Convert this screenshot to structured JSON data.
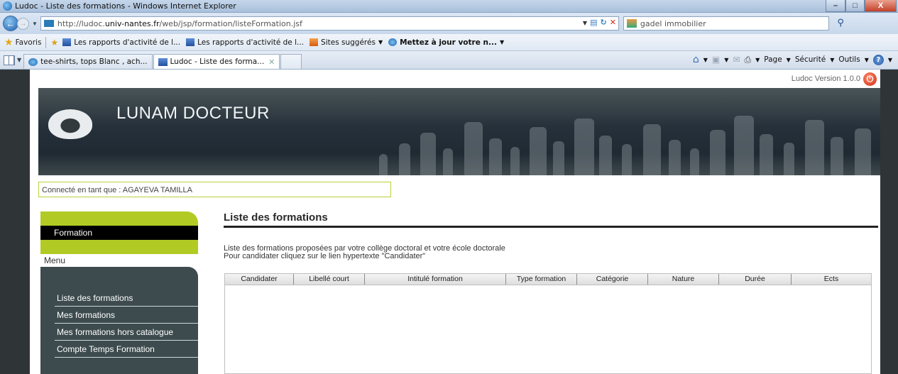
{
  "window": {
    "title": "Ludoc - Liste des formations - Windows Internet Explorer",
    "buttons": {
      "minimize": "–",
      "maximize": "□",
      "close": "X"
    }
  },
  "address": {
    "url_prefix": "http://ludoc.",
    "url_host": "univ-nantes.fr",
    "url_path": "/web/jsp/formation/listeFormation.jsf",
    "search_value": "gadel immobilier"
  },
  "favorites": {
    "label": "Favoris",
    "items": [
      {
        "label": "Les rapports d'activité de l...",
        "icon": "report-icon"
      },
      {
        "label": "Les rapports d'activité de l...",
        "icon": "report-icon"
      },
      {
        "label": "Sites suggérés",
        "icon": "suggested-sites-icon"
      },
      {
        "label": "Mettez à jour votre n...",
        "icon": "ie-icon"
      }
    ]
  },
  "tabs": {
    "items": [
      {
        "label": "tee-shirts, tops Blanc , ach..."
      },
      {
        "label": "Ludoc - Liste des forma..."
      }
    ],
    "commands": {
      "page": "Page",
      "security": "Sécurité",
      "tools": "Outils"
    }
  },
  "app": {
    "version": "Ludoc Version 1.0.0",
    "brand": "LUNAM DOCTEUR",
    "logged_in": "Connecté en tant que : AGAYEVA  TAMILLA"
  },
  "sidebar": {
    "section": "Formation",
    "menu_label": "Menu",
    "items": [
      {
        "label": "Liste des formations"
      },
      {
        "label": "Mes formations"
      },
      {
        "label": "Mes formations hors catalogue"
      },
      {
        "label": "Compte Temps Formation"
      }
    ]
  },
  "main": {
    "title": "Liste des formations",
    "intro_line1": "Liste des formations proposées par votre collège doctoral et votre école doctorale",
    "intro_line2": "Pour candidater cliquez sur le lien hypertexte \"Candidater\"",
    "columns": [
      "Candidater",
      "Libellé court",
      "Intitulé formation",
      "Type formation",
      "Catégorie",
      "Nature",
      "Durée",
      "Ects"
    ]
  },
  "colors": {
    "accent_green": "#b2cb24",
    "sidebar_dark": "#3d4b4e",
    "page_bg": "#2f3537"
  }
}
